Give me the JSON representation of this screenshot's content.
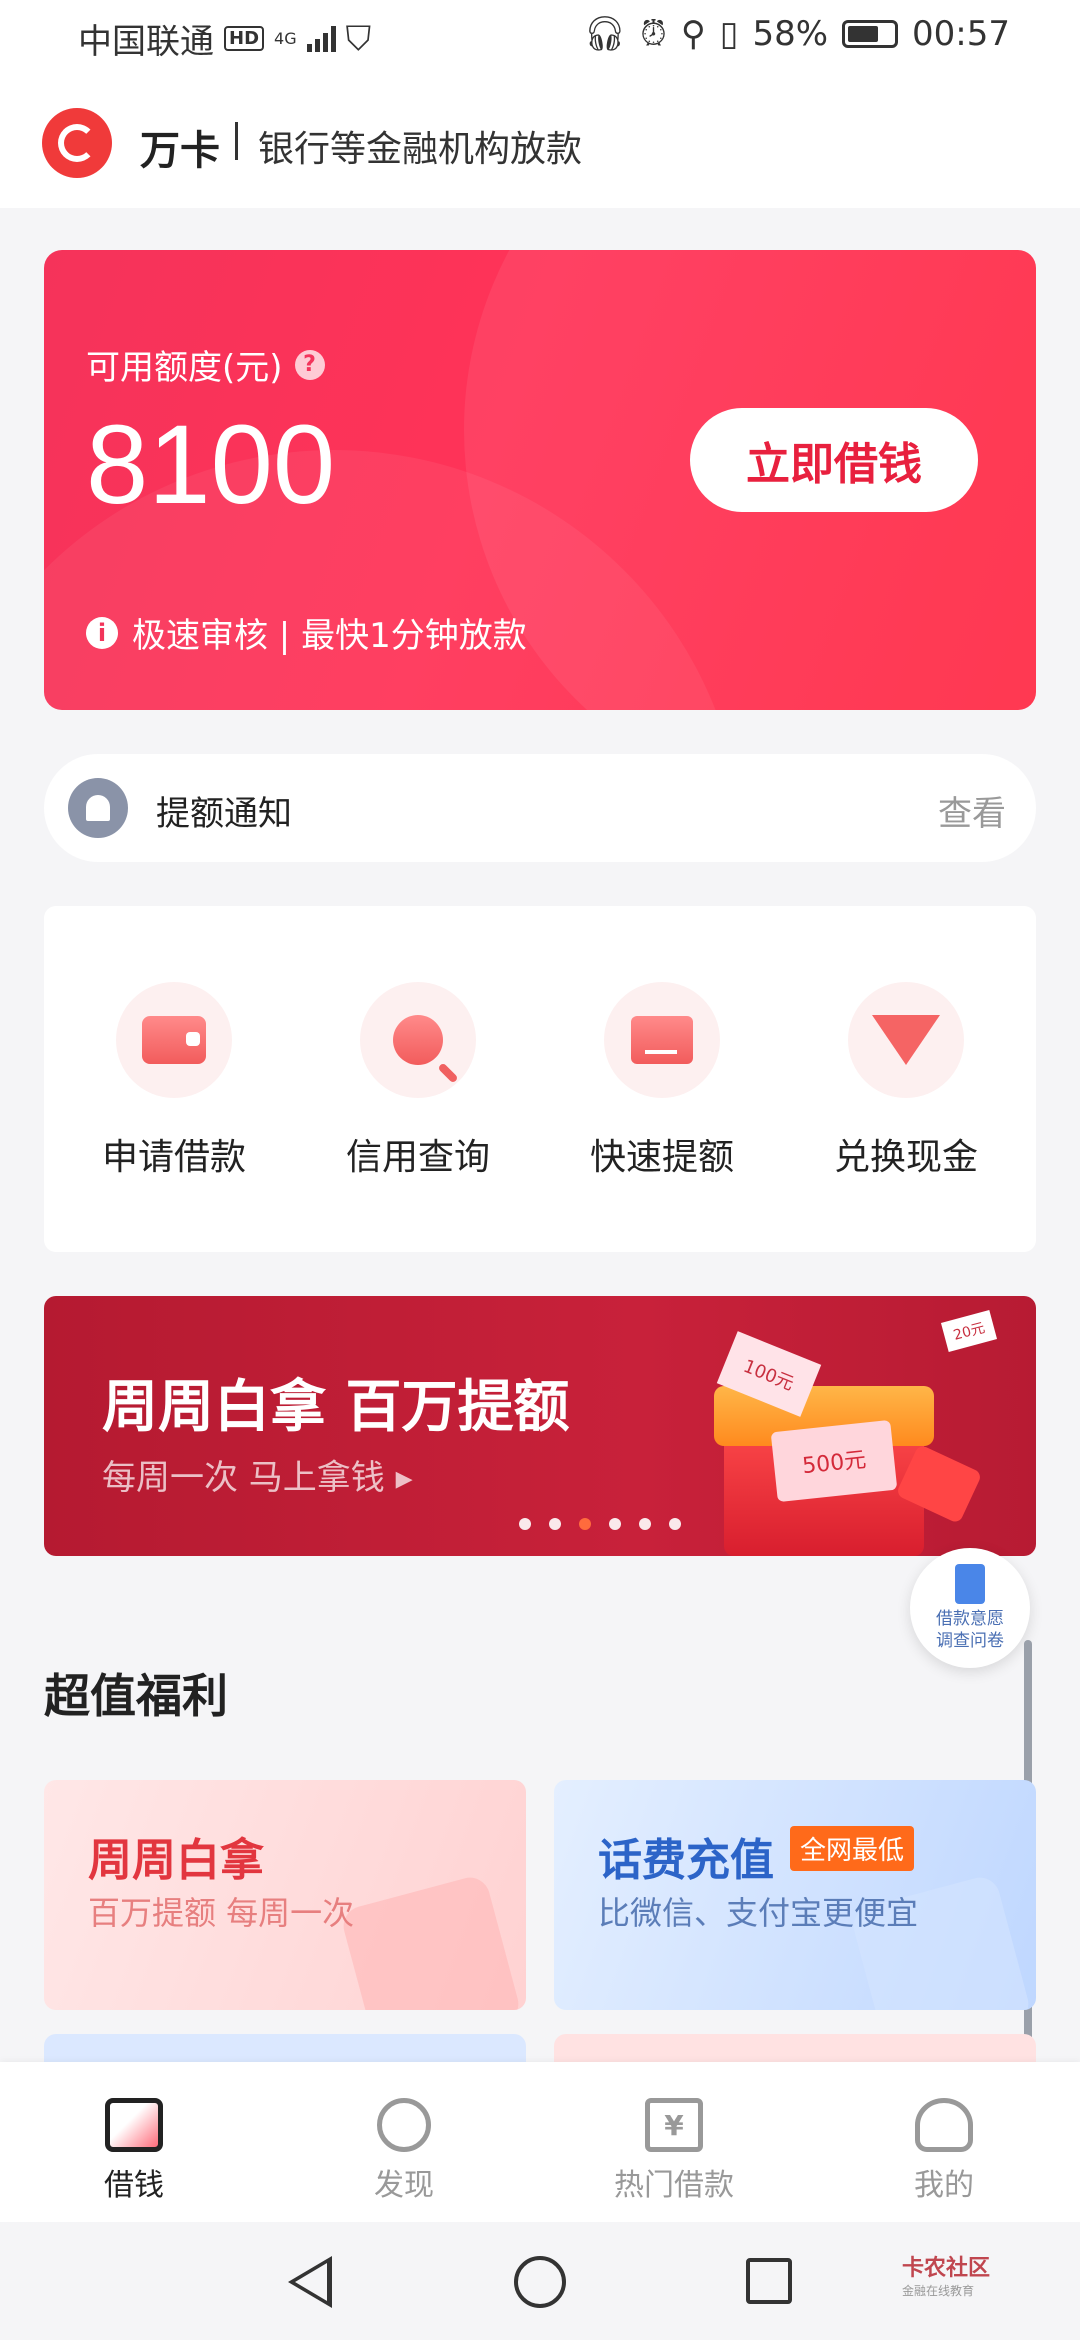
{
  "status_bar": {
    "carrier": "中国联通",
    "hd": "HD",
    "network": "4G",
    "battery": "58%",
    "time": "00:57"
  },
  "header": {
    "brand": "万卡",
    "slogan": "银行等金融机构放款"
  },
  "hero": {
    "quota_label": "可用额度(元)",
    "amount": "8100",
    "cta": "立即借钱",
    "note": "极速审核 | 最快1分钟放款"
  },
  "notice": {
    "text": "提额通知",
    "action": "查看"
  },
  "actions": [
    {
      "label": "申请借款",
      "icon": "wallet-icon"
    },
    {
      "label": "信用查询",
      "icon": "search-icon"
    },
    {
      "label": "快速提额",
      "icon": "raise-icon"
    },
    {
      "label": "兑换现金",
      "icon": "gem-icon"
    }
  ],
  "banner": {
    "title": "周周白拿 百万提额",
    "subtitle": "每周一次  马上拿钱 ▸",
    "ticket": "500元",
    "note": "100元",
    "chip": "20元",
    "active_dot": 3,
    "dot_count": 6
  },
  "survey": {
    "line1": "借款意愿",
    "line2": "调查问卷"
  },
  "section": {
    "title": "超值福利"
  },
  "cards": [
    {
      "title": "周周白拿",
      "subtitle": "百万提额 每周一次"
    },
    {
      "title": "话费充值",
      "badge": "全网最低",
      "subtitle": "比微信、支付宝更便宜"
    }
  ],
  "tabs": [
    {
      "label": "借钱",
      "active": true
    },
    {
      "label": "发现",
      "active": false
    },
    {
      "label": "热门借款",
      "active": false
    },
    {
      "label": "我的",
      "active": false
    }
  ],
  "watermark": {
    "title": "卡农社区",
    "sub": "金融在线教育"
  },
  "colors": {
    "accent": "#f5335a",
    "banner": "#c8213a"
  }
}
